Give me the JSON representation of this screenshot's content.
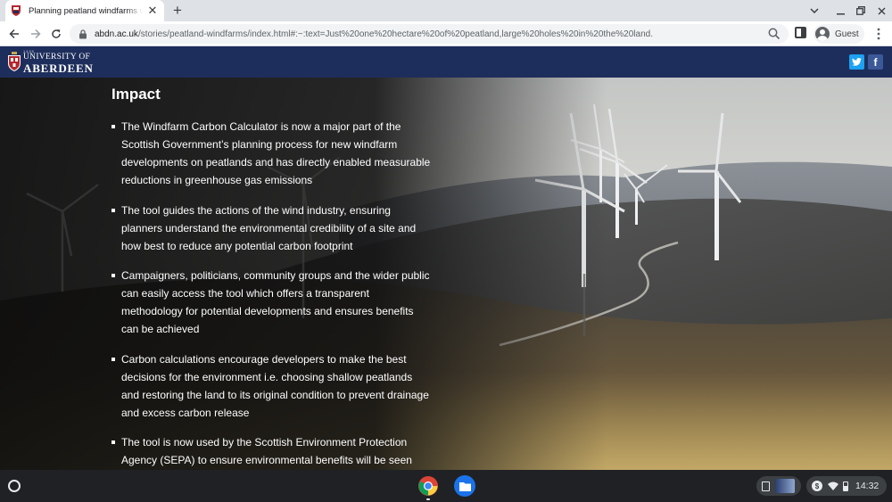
{
  "browser": {
    "tab": {
      "title": "Planning peatland windfarms w",
      "favicon": "aberdeen-crest-icon",
      "close_icon": "close-icon"
    },
    "new_tab_icon": "plus-icon",
    "window_controls": [
      "chevron-down-icon",
      "minimize-icon",
      "restore-icon",
      "close-icon"
    ],
    "nav": {
      "back": "back-arrow-icon",
      "forward": "forward-arrow-icon",
      "reload": "reload-icon"
    },
    "address": {
      "domain": "abdn.ac.uk",
      "path": "/stories/peatland-windfarms/index.html#:~:text=Just%20one%20hectare%20of%20peatland,large%20holes%20in%20the%20land."
    },
    "profile_name": "Guest"
  },
  "site": {
    "logo": {
      "year": "1495",
      "line1": "UNIVERSITY OF",
      "line2": "ABERDEEN"
    },
    "social": [
      "twitter-icon",
      "facebook-icon"
    ],
    "facebook_glyph": "f"
  },
  "content": {
    "heading": "Impact",
    "bullets": [
      "The Windfarm Carbon Calculator is now a major part of the Scottish Government’s planning process for new windfarm developments on peatlands and has directly enabled measurable reductions in greenhouse gas emissions",
      "The tool guides the actions of the wind industry, ensuring planners understand the environmental credibility of a site and how best to reduce any potential carbon footprint",
      "Campaigners, politicians, community groups and the wider public can easily access the tool which offers a transparent methodology for potential developments and ensures benefits can be achieved",
      "Carbon calculations encourage developers to make the best decisions for the environment i.e. choosing shallow peatlands and restoring the land to its original condition to prevent drainage and excess carbon release",
      "The tool is now used by the Scottish Environment Protection Agency (SEPA) to ensure environmental benefits will be seen from all new peatland developments"
    ]
  },
  "shelf": {
    "apps": [
      "chrome-icon",
      "files-icon"
    ],
    "status": {
      "time": "14:32",
      "dollar": "$"
    }
  },
  "colors": {
    "header_bg": "#1e2e5c",
    "twitter": "#1da1f2",
    "facebook": "#3b5998",
    "shelf": "#202124"
  }
}
